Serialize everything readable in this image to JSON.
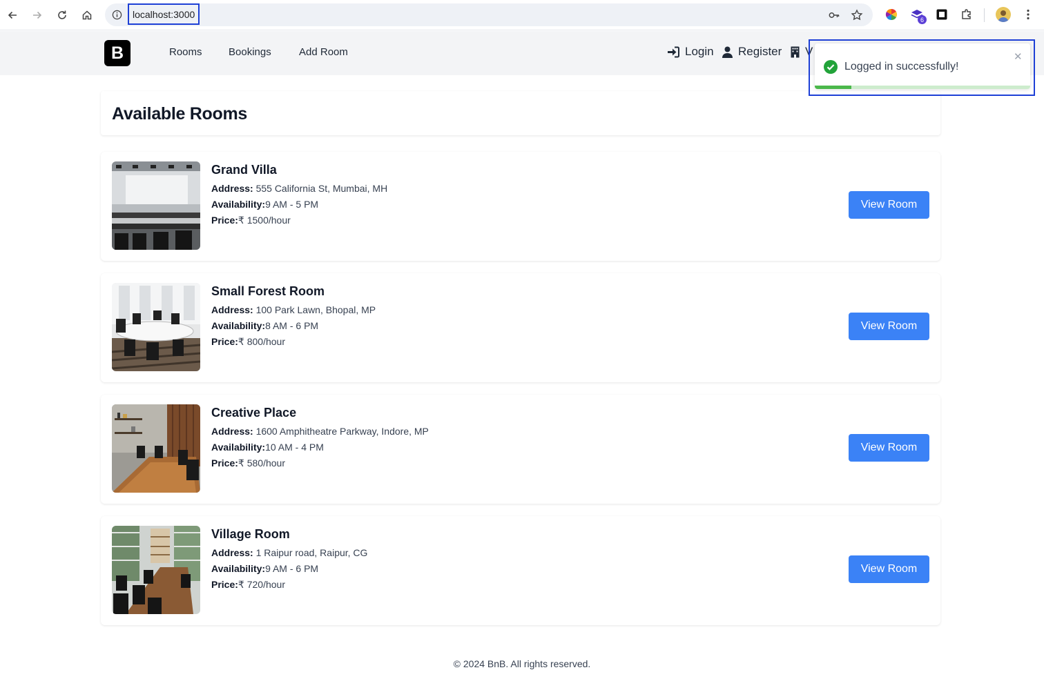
{
  "browser": {
    "url": "localhost:3000",
    "extension_badge": "6"
  },
  "header": {
    "logo_letter": "B",
    "nav": [
      "Rooms",
      "Bookings",
      "Add Room"
    ],
    "login_label": "Login",
    "register_label": "Register",
    "cut_off_label": "V"
  },
  "page": {
    "title": "Available Rooms",
    "address_label": "Address:",
    "availability_label": "Availability:",
    "price_label": "Price:",
    "view_button_label": "View Room"
  },
  "rooms": [
    {
      "name": "Grand Villa",
      "address": "555 California St, Mumbai, MH",
      "availability": "9 AM - 5 PM",
      "price": "₹ 1500/hour"
    },
    {
      "name": "Small Forest Room",
      "address": "100 Park Lawn, Bhopal, MP",
      "availability": "8 AM - 6 PM",
      "price": "₹ 800/hour"
    },
    {
      "name": "Creative Place",
      "address": "1600 Amphitheatre Parkway, Indore, MP",
      "availability": "10 AM - 4 PM",
      "price": "₹ 580/hour"
    },
    {
      "name": "Village Room",
      "address": "1 Raipur road, Raipur, CG",
      "availability": "9 AM - 6 PM",
      "price": "₹ 720/hour"
    }
  ],
  "footer": {
    "text": "© 2024 BnB. All rights reserved."
  },
  "toast": {
    "message": "Logged in successfully!",
    "close": "✕",
    "progress": 0.17
  },
  "colors": {
    "accent": "#3b82f6",
    "success": "#22a33a",
    "highlight": "#1d3fd6"
  }
}
